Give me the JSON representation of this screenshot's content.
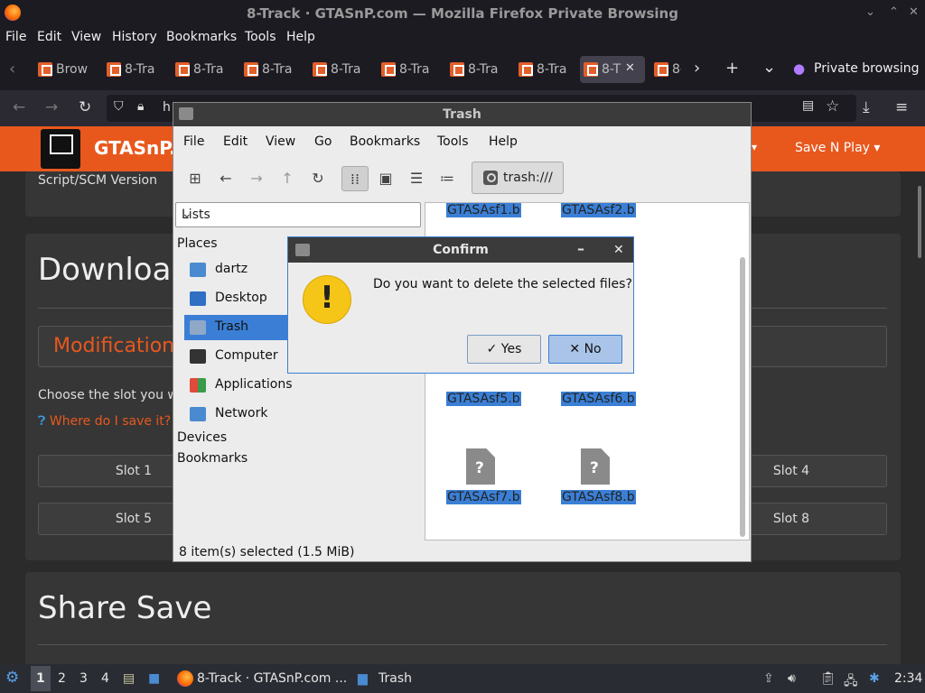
{
  "browser": {
    "window_title": "8-Track · GTASnP.com — Mozilla Firefox Private Browsing",
    "menu": [
      "File",
      "Edit",
      "View",
      "History",
      "Bookmarks",
      "Tools",
      "Help"
    ],
    "tabs": [
      "Brow",
      "8-Tra",
      "8-Tra",
      "8-Tra",
      "8-Tra",
      "8-Tra",
      "8-Tra",
      "8-Tra",
      "8-T",
      "8-"
    ],
    "private_label": "Private browsing",
    "url_prefix": "h"
  },
  "site": {
    "brand": "GTASnP.c",
    "save_menu": "Save N Play ▾",
    "script_version": "Script/SCM Version",
    "download_heading": "Downloa",
    "modification": "Modification",
    "choose_slot": "Choose the slot you wis",
    "where_save": "Where do I save it?",
    "slots": [
      "Slot 1",
      "Slot 4",
      "Slot 5",
      "Slot 8"
    ],
    "share_heading": "Share Save"
  },
  "file_manager": {
    "title": "Trash",
    "menu": [
      "File",
      "Edit",
      "View",
      "Go",
      "Bookmarks",
      "Tools",
      "Help"
    ],
    "path": "trash:///",
    "side_pane_mode": "Lists",
    "places_heading": "Places",
    "places": [
      "dartz",
      "Desktop",
      "Trash",
      "Computer",
      "Applications",
      "Network"
    ],
    "devices_heading": "Devices",
    "bookmarks_heading": "Bookmarks",
    "files": [
      "GTASAsf1.b",
      "GTASAsf2.b",
      "GTASAsf5.b",
      "GTASAsf6.b",
      "GTASAsf7.b",
      "GTASAsf8.b"
    ],
    "status": "8 item(s) selected (1.5 MiB)"
  },
  "dialog": {
    "title": "Confirm",
    "message": "Do you want to delete the selected files?",
    "yes": "Yes",
    "no": "No"
  },
  "taskbar": {
    "workspaces": [
      "1",
      "2",
      "3",
      "4"
    ],
    "firefox_task": "8-Track · GTASnP.com ...",
    "trash_task": "Trash",
    "clock": "2:34"
  },
  "colors": {
    "accent": "#e8581d",
    "selection": "#3a7fd5"
  }
}
